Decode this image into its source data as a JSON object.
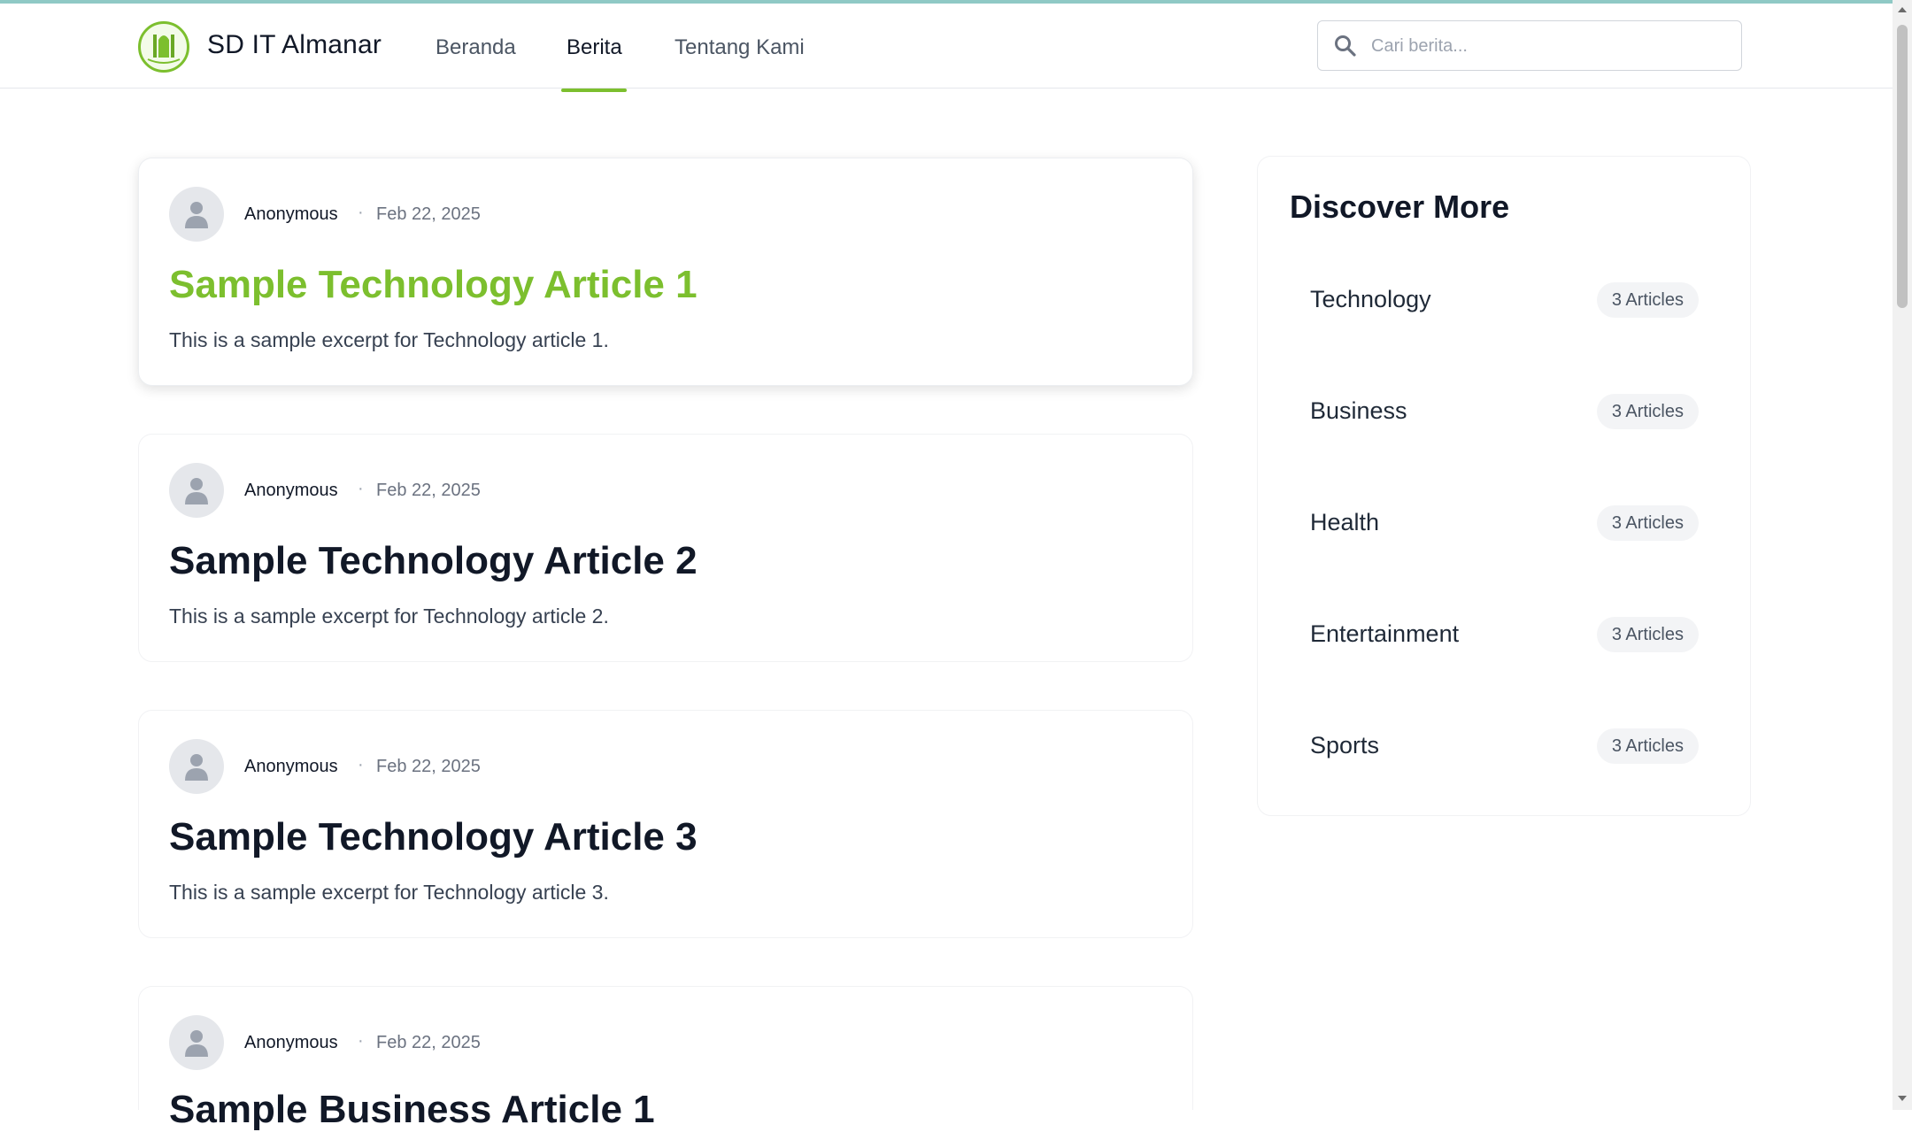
{
  "header": {
    "brand": "SD IT Almanar",
    "nav": [
      {
        "label": "Beranda",
        "active": false
      },
      {
        "label": "Berita",
        "active": true
      },
      {
        "label": "Tentang Kami",
        "active": false
      }
    ],
    "search_placeholder": "Cari berita..."
  },
  "articles": [
    {
      "author": "Anonymous",
      "separator": "·",
      "date": "Feb 22, 2025",
      "title": "Sample Technology Article 1",
      "excerpt": "This is a sample excerpt for Technology article 1.",
      "featured": true
    },
    {
      "author": "Anonymous",
      "separator": "·",
      "date": "Feb 22, 2025",
      "title": "Sample Technology Article 2",
      "excerpt": "This is a sample excerpt for Technology article 2.",
      "featured": false
    },
    {
      "author": "Anonymous",
      "separator": "·",
      "date": "Feb 22, 2025",
      "title": "Sample Technology Article 3",
      "excerpt": "This is a sample excerpt for Technology article 3.",
      "featured": false
    },
    {
      "author": "Anonymous",
      "separator": "·",
      "date": "Feb 22, 2025",
      "title": "Sample Business Article 1",
      "excerpt": "",
      "featured": false
    }
  ],
  "sidebar": {
    "title": "Discover More",
    "categories": [
      {
        "name": "Technology",
        "count": "3 Articles"
      },
      {
        "name": "Business",
        "count": "3 Articles"
      },
      {
        "name": "Health",
        "count": "3 Articles"
      },
      {
        "name": "Entertainment",
        "count": "3 Articles"
      },
      {
        "name": "Sports",
        "count": "3 Articles"
      }
    ]
  },
  "colors": {
    "accent": "#7cbf2e",
    "topline": "#8fc9c5"
  },
  "icons": {
    "search": "search-icon",
    "avatar": "user-icon",
    "logo": "school-logo"
  }
}
